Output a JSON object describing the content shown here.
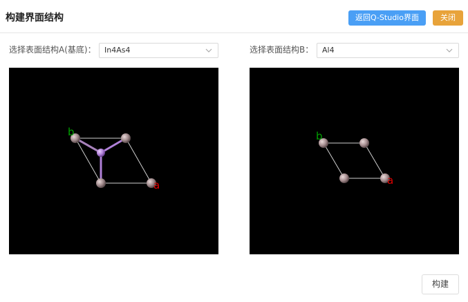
{
  "header": {
    "title": "构建界面结构",
    "return_button": "返回Q-Studio界面",
    "close_button": "关闭"
  },
  "structure_a": {
    "label": "选择表面结构A(基底)：",
    "selected": "In4As4",
    "axis_a": "a",
    "axis_b": "b"
  },
  "structure_b": {
    "label": "选择表面结构B：",
    "selected": "Al4",
    "axis_a": "a",
    "axis_b": "b"
  },
  "footer": {
    "build_button": "构建"
  },
  "colors": {
    "primary": "#4a9ff5",
    "warning": "#e8a33a",
    "atom_in": "#a08a8c",
    "atom_as": "#b080d8",
    "axis_a": "#e00000",
    "axis_b": "#00a000"
  }
}
